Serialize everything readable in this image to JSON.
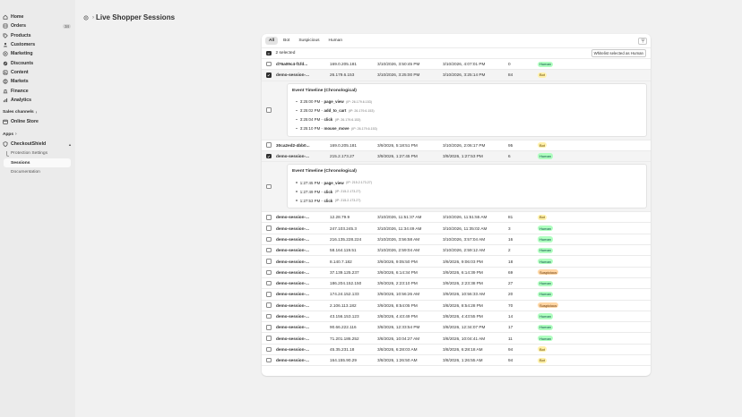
{
  "sidebar": {
    "nav": [
      {
        "label": "Home",
        "icon": "home-icon",
        "name": "home"
      },
      {
        "label": "Orders",
        "icon": "orders-icon",
        "name": "orders",
        "badge": "34"
      },
      {
        "label": "Products",
        "icon": "tag-icon",
        "name": "products"
      },
      {
        "label": "Customers",
        "icon": "person-icon",
        "name": "customers"
      },
      {
        "label": "Marketing",
        "icon": "target-icon",
        "name": "marketing"
      },
      {
        "label": "Discounts",
        "icon": "discount-icon",
        "name": "discounts"
      },
      {
        "label": "Content",
        "icon": "content-icon",
        "name": "content"
      },
      {
        "label": "Markets",
        "icon": "globe-icon",
        "name": "markets"
      },
      {
        "label": "Finance",
        "icon": "bank-icon",
        "name": "finance"
      },
      {
        "label": "Analytics",
        "icon": "chart-icon",
        "name": "analytics"
      }
    ],
    "sales_channels_label": "Sales channels",
    "online_store_label": "Online Store",
    "apps_label": "Apps",
    "app_name": "CheckoutShield",
    "app_sub": [
      "Protection Settings",
      "Sessions",
      "Documentation"
    ]
  },
  "page": {
    "title": "Live Shopper Sessions"
  },
  "tabs": [
    "All",
    "Bot",
    "Suspicious",
    "Human"
  ],
  "selection": {
    "count_text": "2 selected",
    "whitelist_label": "Whitelist selected as Human"
  },
  "colors": {
    "human": "#affebf",
    "bot": "#fff0a8",
    "suspicious": "#ffd6a4"
  },
  "timeline_title": "Event Timeline (Chronological)",
  "rows": [
    {
      "id": "d76a09c4-f1fd...",
      "ip": "169.0.205.181",
      "first": "3/10/2026, 3:50:45 PM",
      "last": "3/10/2026, 4:07:01 PM",
      "score": "0",
      "label": "Human",
      "cls": "human",
      "checked": false
    },
    {
      "id": "demo-session-...",
      "ip": "26.179.6.153",
      "first": "3/10/2026, 3:25:00 PM",
      "last": "3/10/2026, 3:25:14 PM",
      "score": "84",
      "label": "Bot",
      "cls": "bot",
      "checked": true,
      "events": [
        {
          "time": "3:25:00 PM",
          "action": "page_view",
          "ip": "(IP: 26.179.6.153)"
        },
        {
          "time": "3:25:02 PM",
          "action": "add_to_cart",
          "ip": "(IP: 26.179.6.153)"
        },
        {
          "time": "3:25:04 PM",
          "action": "click",
          "ip": "(IP: 26.179.6.153)"
        },
        {
          "time": "3:25:10 PM",
          "action": "mouse_move",
          "ip": "(IP: 26.179.6.153)"
        }
      ]
    },
    {
      "id": "30ca2ed2-4bb0...",
      "ip": "169.0.205.181",
      "first": "3/9/2026, 5:18:51 PM",
      "last": "3/10/2026, 2:06:17 PM",
      "score": "95",
      "label": "Bot",
      "cls": "bot",
      "checked": false
    },
    {
      "id": "demo-session-...",
      "ip": "215.2.173.27",
      "first": "3/9/2026, 1:27:45 PM",
      "last": "3/9/2026, 1:27:53 PM",
      "score": "6",
      "label": "Human",
      "cls": "human",
      "checked": true,
      "events": [
        {
          "time": "1:27:45 PM",
          "action": "page_view",
          "ip": "(IP: 215.2.173.27)"
        },
        {
          "time": "1:27:49 PM",
          "action": "click",
          "ip": "(IP: 215.2.173.27)"
        },
        {
          "time": "1:27:53 PM",
          "action": "click",
          "ip": "(IP: 215.2.173.27)"
        }
      ]
    },
    {
      "id": "demo-session-...",
      "ip": "12.28.79.9",
      "first": "3/10/2026, 11:51:37 AM",
      "last": "3/10/2026, 11:51:55 AM",
      "score": "81",
      "label": "Bot",
      "cls": "bot",
      "checked": false
    },
    {
      "id": "demo-session-...",
      "ip": "247.103.245.3",
      "first": "3/10/2026, 11:34:49 AM",
      "last": "3/10/2026, 11:35:02 AM",
      "score": "3",
      "label": "Human",
      "cls": "human",
      "checked": false
    },
    {
      "id": "demo-session-...",
      "ip": "216.135.228.224",
      "first": "3/10/2026, 3:56:58 AM",
      "last": "3/10/2026, 3:57:04 AM",
      "score": "16",
      "label": "Human",
      "cls": "human",
      "checked": false
    },
    {
      "id": "demo-session-...",
      "ip": "58.164.119.51",
      "first": "3/10/2026, 2:59:04 AM",
      "last": "3/10/2026, 2:59:12 AM",
      "score": "2",
      "label": "Human",
      "cls": "human",
      "checked": false
    },
    {
      "id": "demo-session-...",
      "ip": "8.140.7.182",
      "first": "3/9/2026, 9:05:50 PM",
      "last": "3/9/2026, 9:06:03 PM",
      "score": "18",
      "label": "Human",
      "cls": "human",
      "checked": false
    },
    {
      "id": "demo-session-...",
      "ip": "37.139.125.237",
      "first": "3/9/2026, 6:14:34 PM",
      "last": "3/9/2026, 6:14:39 PM",
      "score": "69",
      "label": "Suspicious",
      "cls": "sus",
      "checked": false
    },
    {
      "id": "demo-session-...",
      "ip": "186.204.152.150",
      "first": "3/9/2026, 2:23:10 PM",
      "last": "3/9/2026, 2:23:38 PM",
      "score": "27",
      "label": "Human",
      "cls": "human",
      "checked": false
    },
    {
      "id": "demo-session-...",
      "ip": "174.24.152.133",
      "first": "3/9/2026, 10:56:26 AM",
      "last": "3/9/2026, 10:56:33 AM",
      "score": "20",
      "label": "Human",
      "cls": "human",
      "checked": false
    },
    {
      "id": "demo-session-...",
      "ip": "2.106.113.182",
      "first": "3/9/2026, 8:54:05 PM",
      "last": "3/8/2026, 8:54:28 PM",
      "score": "70",
      "label": "Suspicious",
      "cls": "sus",
      "checked": false
    },
    {
      "id": "demo-session-...",
      "ip": "43.156.153.123",
      "first": "3/8/2026, 4:43:49 PM",
      "last": "3/8/2026, 4:43:55 PM",
      "score": "14",
      "label": "Human",
      "cls": "human",
      "checked": false
    },
    {
      "id": "demo-session-...",
      "ip": "90.66.222.116",
      "first": "3/8/2026, 12:33:54 PM",
      "last": "3/8/2026, 12:34:07 PM",
      "score": "17",
      "label": "Human",
      "cls": "human",
      "checked": false
    },
    {
      "id": "demo-session-...",
      "ip": "71.201.186.252",
      "first": "3/8/2026, 10:04:27 AM",
      "last": "3/8/2026, 10:04:41 AM",
      "score": "11",
      "label": "Human",
      "cls": "human",
      "checked": false
    },
    {
      "id": "demo-session-...",
      "ip": "45.35.231.18",
      "first": "3/8/2026, 6:28:03 AM",
      "last": "3/8/2026, 6:28:18 AM",
      "score": "94",
      "label": "Bot",
      "cls": "bot",
      "checked": false
    },
    {
      "id": "demo-session-...",
      "ip": "164.155.90.29",
      "first": "3/8/2026, 1:26:50 AM",
      "last": "3/8/2026, 1:26:55 AM",
      "score": "94",
      "label": "Bot",
      "cls": "bot",
      "checked": false
    }
  ]
}
